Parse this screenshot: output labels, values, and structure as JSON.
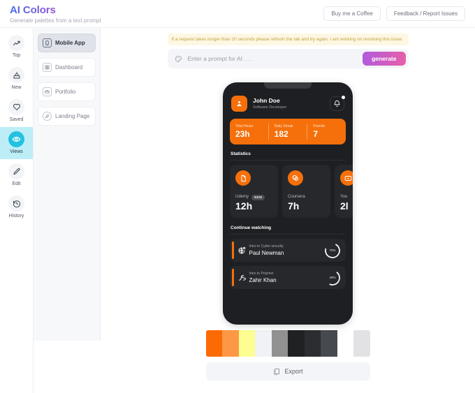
{
  "header": {
    "brand_title": "AI Colors",
    "brand_subtitle": "Generate palettes from a text prompt",
    "buy_coffee_label": "Buy me a Coffee",
    "feedback_label": "Feedback / Report Issues"
  },
  "rail": {
    "items": [
      {
        "label": "Top",
        "icon": "trending-up-icon",
        "active": false
      },
      {
        "label": "New",
        "icon": "cake-icon",
        "active": false
      },
      {
        "label": "Saved",
        "icon": "heart-icon",
        "active": false
      },
      {
        "label": "Views",
        "icon": "eye-icon",
        "active": true
      },
      {
        "label": "Edit",
        "icon": "pencil-icon",
        "active": false
      },
      {
        "label": "History",
        "icon": "history-icon",
        "active": false
      }
    ],
    "active_color": "#24c1e0",
    "active_bg": "#bdeef8"
  },
  "nav_panel": {
    "items": [
      {
        "label": "Mobile App",
        "icon": "phone-icon",
        "selected": true
      },
      {
        "label": "Dashboard",
        "icon": "grid-icon",
        "selected": false
      },
      {
        "label": "Portfolio",
        "icon": "briefcase-icon",
        "selected": false
      },
      {
        "label": "Landing Page",
        "icon": "rocket-icon",
        "selected": false
      }
    ]
  },
  "main": {
    "notice": "If a request takes longer than 20 seconds please refresh the tab and try again. I am working on resolving this issue.",
    "prompt_placeholder": "Enter a prompt for AI . . .",
    "prompt_value": "",
    "prompt_icon": "palette-icon",
    "generate_label": "generate",
    "export_label": "Export",
    "export_icon": "copy-icon"
  },
  "preview": {
    "profile": {
      "name": "John Doe",
      "role": "Software Developer",
      "avatar_icon": "person-icon",
      "bell_icon": "bell-icon",
      "has_notification": true
    },
    "stats_bar": [
      {
        "label": "Total Hours",
        "value": "23h"
      },
      {
        "label": "Daily Streak",
        "value": "182"
      },
      {
        "label": "Friends",
        "value": "7"
      }
    ],
    "statistics_title": "Statistics",
    "statistics_cards": [
      {
        "name": "Udemy",
        "value": "12h",
        "badge": "NEW",
        "icon": "document-icon"
      },
      {
        "name": "Coursera",
        "value": "7h",
        "badge": "",
        "icon": "coursera-icon"
      },
      {
        "name": "You",
        "value": "2l",
        "badge": "",
        "icon": "youtube-icon"
      }
    ],
    "continue_title": "Continue watching",
    "continue_items": [
      {
        "course": "Intro to Cyber-security",
        "author": "Paul Newman",
        "percent": 70,
        "percent_label": "70%",
        "icon": "globe-lock-icon"
      },
      {
        "course": "Intro to Polymer",
        "author": "Zahir Khan",
        "percent": 45,
        "percent_label": "45%",
        "icon": "polymer-icon"
      }
    ],
    "accent_color": "#f5700b",
    "surface_color": "#1d1f22",
    "card_color": "#26282c"
  },
  "palette": {
    "swatches": [
      "#fc6a04",
      "#fe9845",
      "#fdfd91",
      "#f1f2f5",
      "#919191",
      "#1f2123",
      "#2b2d30",
      "#464a4e",
      "#ffffff",
      "#e2e2e4"
    ]
  }
}
